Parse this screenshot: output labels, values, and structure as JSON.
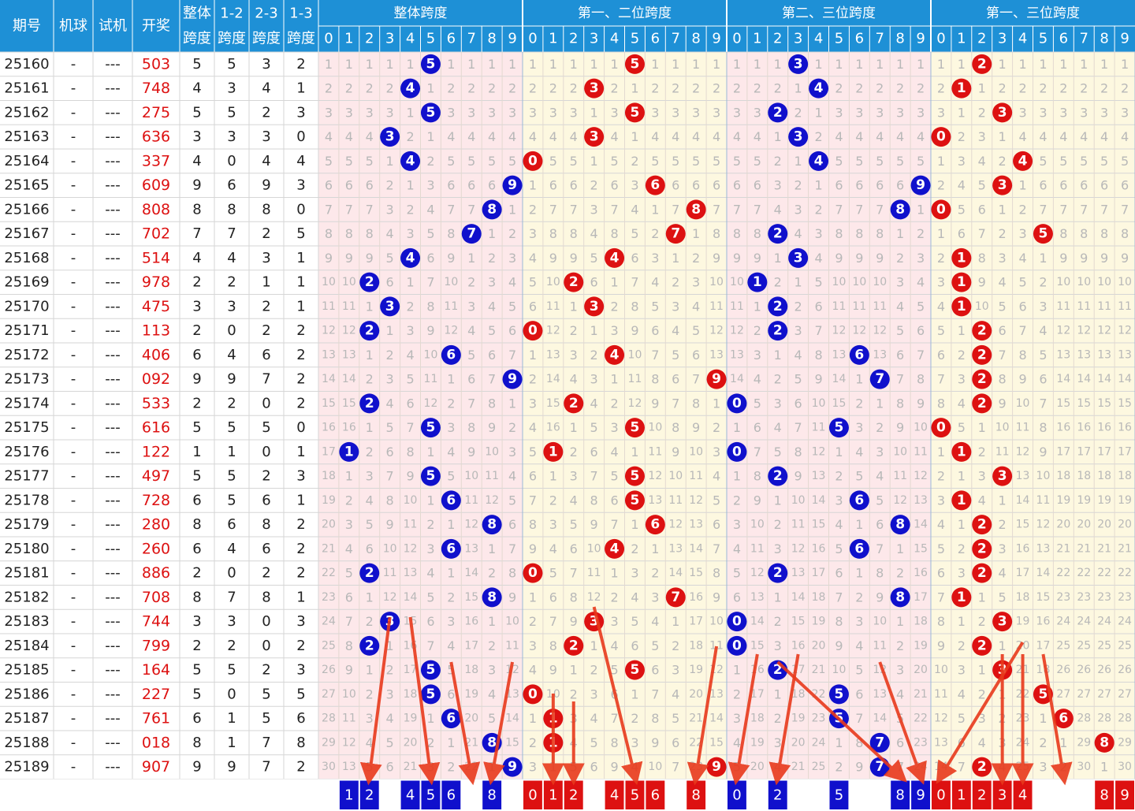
{
  "header": {
    "period": "期号",
    "machine": "机球",
    "trial": "试机",
    "draw": "开奖",
    "span_overall": [
      "整体",
      "跨度"
    ],
    "span_12": [
      "1-2",
      "跨度"
    ],
    "span_23": [
      "2-3",
      "跨度"
    ],
    "span_13": [
      "1-3",
      "跨度"
    ],
    "groups": [
      "整体跨度",
      "第一、二位跨度",
      "第二、三位跨度",
      "第一、三位跨度"
    ],
    "digits": [
      "0",
      "1",
      "2",
      "3",
      "4",
      "5",
      "6",
      "7",
      "8",
      "9"
    ]
  },
  "colors": {
    "header_bg": "#1e90d6",
    "header_text": "#ffffff",
    "draw_text": "#dd1111",
    "pink_bg": "#fde8ea",
    "yellow_bg": "#fdf8e0",
    "blue_ball": "#1010cc",
    "red_ball": "#dd1111",
    "arrow": "#e83a1c",
    "miss_text": "#b8b8b8"
  },
  "chart_data": {
    "type": "table",
    "rows": [
      {
        "period": "25160",
        "machine": "-",
        "trial": "---",
        "draw": "503",
        "span": [
          5,
          5,
          3,
          2
        ]
      },
      {
        "period": "25161",
        "machine": "-",
        "trial": "---",
        "draw": "748",
        "span": [
          4,
          3,
          4,
          1
        ]
      },
      {
        "period": "25162",
        "machine": "-",
        "trial": "---",
        "draw": "275",
        "span": [
          5,
          5,
          2,
          3
        ]
      },
      {
        "period": "25163",
        "machine": "-",
        "trial": "---",
        "draw": "636",
        "span": [
          3,
          3,
          3,
          0
        ]
      },
      {
        "period": "25164",
        "machine": "-",
        "trial": "---",
        "draw": "337",
        "span": [
          4,
          0,
          4,
          4
        ]
      },
      {
        "period": "25165",
        "machine": "-",
        "trial": "---",
        "draw": "609",
        "span": [
          9,
          6,
          9,
          3
        ]
      },
      {
        "period": "25166",
        "machine": "-",
        "trial": "---",
        "draw": "808",
        "span": [
          8,
          8,
          8,
          0
        ]
      },
      {
        "period": "25167",
        "machine": "-",
        "trial": "---",
        "draw": "702",
        "span": [
          7,
          7,
          2,
          5
        ]
      },
      {
        "period": "25168",
        "machine": "-",
        "trial": "---",
        "draw": "514",
        "span": [
          4,
          4,
          3,
          1
        ]
      },
      {
        "period": "25169",
        "machine": "-",
        "trial": "---",
        "draw": "978",
        "span": [
          2,
          2,
          1,
          1
        ]
      },
      {
        "period": "25170",
        "machine": "-",
        "trial": "---",
        "draw": "475",
        "span": [
          3,
          3,
          2,
          1
        ]
      },
      {
        "period": "25171",
        "machine": "-",
        "trial": "---",
        "draw": "113",
        "span": [
          2,
          0,
          2,
          2
        ]
      },
      {
        "period": "25172",
        "machine": "-",
        "trial": "---",
        "draw": "406",
        "span": [
          6,
          4,
          6,
          2
        ]
      },
      {
        "period": "25173",
        "machine": "-",
        "trial": "---",
        "draw": "092",
        "span": [
          9,
          9,
          7,
          2
        ]
      },
      {
        "period": "25174",
        "machine": "-",
        "trial": "---",
        "draw": "533",
        "span": [
          2,
          2,
          0,
          2
        ]
      },
      {
        "period": "25175",
        "machine": "-",
        "trial": "---",
        "draw": "616",
        "span": [
          5,
          5,
          5,
          0
        ]
      },
      {
        "period": "25176",
        "machine": "-",
        "trial": "---",
        "draw": "122",
        "span": [
          1,
          1,
          0,
          1
        ]
      },
      {
        "period": "25177",
        "machine": "-",
        "trial": "---",
        "draw": "497",
        "span": [
          5,
          5,
          2,
          3
        ]
      },
      {
        "period": "25178",
        "machine": "-",
        "trial": "---",
        "draw": "728",
        "span": [
          6,
          5,
          6,
          1
        ]
      },
      {
        "period": "25179",
        "machine": "-",
        "trial": "---",
        "draw": "280",
        "span": [
          8,
          6,
          8,
          2
        ]
      },
      {
        "period": "25180",
        "machine": "-",
        "trial": "---",
        "draw": "260",
        "span": [
          6,
          4,
          6,
          2
        ]
      },
      {
        "period": "25181",
        "machine": "-",
        "trial": "---",
        "draw": "886",
        "span": [
          2,
          0,
          2,
          2
        ]
      },
      {
        "period": "25182",
        "machine": "-",
        "trial": "---",
        "draw": "708",
        "span": [
          8,
          7,
          8,
          1
        ]
      },
      {
        "period": "25183",
        "machine": "-",
        "trial": "---",
        "draw": "744",
        "span": [
          3,
          3,
          0,
          3
        ]
      },
      {
        "period": "25184",
        "machine": "-",
        "trial": "---",
        "draw": "799",
        "span": [
          2,
          2,
          0,
          2
        ]
      },
      {
        "period": "25185",
        "machine": "-",
        "trial": "---",
        "draw": "164",
        "span": [
          5,
          5,
          2,
          3
        ]
      },
      {
        "period": "25186",
        "machine": "-",
        "trial": "---",
        "draw": "227",
        "span": [
          5,
          0,
          5,
          5
        ]
      },
      {
        "period": "25187",
        "machine": "-",
        "trial": "---",
        "draw": "761",
        "span": [
          6,
          1,
          5,
          6
        ]
      },
      {
        "period": "25188",
        "machine": "-",
        "trial": "---",
        "draw": "018",
        "span": [
          8,
          1,
          7,
          8
        ]
      },
      {
        "period": "25189",
        "machine": "-",
        "trial": "---",
        "draw": "907",
        "span": [
          9,
          9,
          7,
          2
        ]
      }
    ],
    "miss_start": [
      [
        0,
        0,
        0,
        0,
        0,
        3,
        0,
        0,
        0,
        0
      ],
      [
        0,
        0,
        0,
        0,
        0,
        3,
        0,
        0,
        0,
        0
      ],
      [
        0,
        0,
        0,
        3,
        0,
        0,
        0,
        0,
        0,
        0
      ],
      [
        0,
        0,
        3,
        0,
        0,
        0,
        0,
        0,
        0,
        0
      ]
    ],
    "prediction": [
      [
        1,
        2,
        4,
        5,
        6,
        8
      ],
      [
        0,
        1,
        2,
        4,
        5,
        6,
        8
      ],
      [
        0,
        2,
        5,
        8,
        9
      ],
      [
        0,
        1,
        2,
        3,
        4,
        8,
        9
      ]
    ]
  }
}
